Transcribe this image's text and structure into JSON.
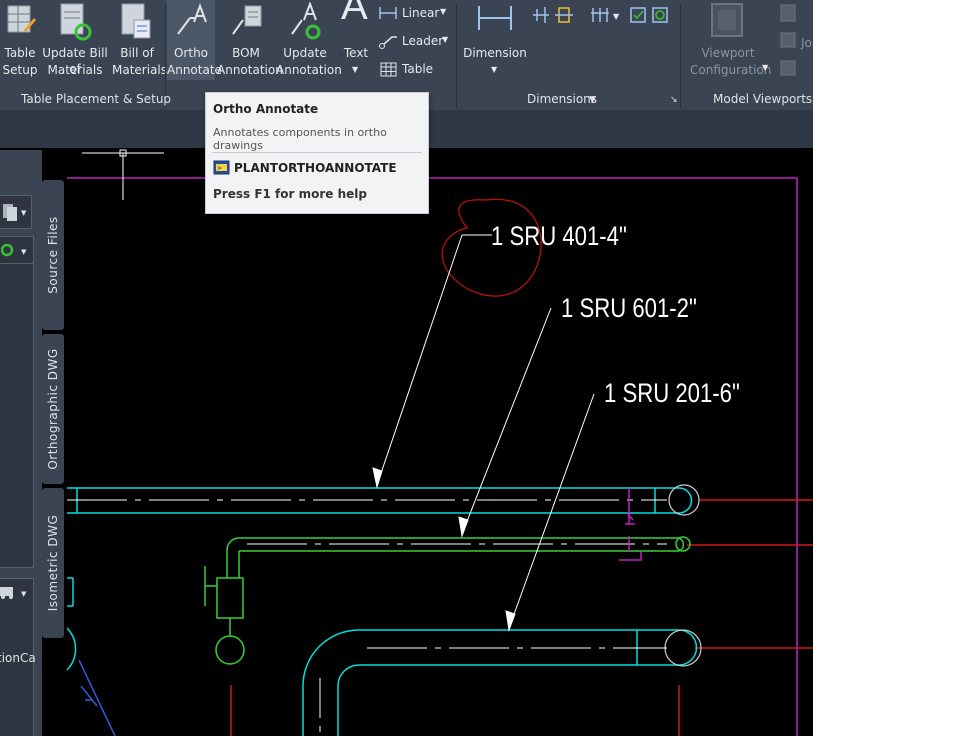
{
  "ribbon": {
    "buttons": {
      "table_setup": [
        "Table",
        "Setup"
      ],
      "update_bom": [
        "Update Bill of",
        "Materials"
      ],
      "bill_of_materials": [
        "Bill of",
        "Materials"
      ],
      "ortho_annotate": [
        "Ortho",
        "Annotate"
      ],
      "bom_annotation": [
        "BOM",
        "Annotation"
      ],
      "update_annotation": [
        "Update",
        "Annotation"
      ],
      "text": "Text",
      "linear": "Linear",
      "leader": "Leader",
      "table": "Table",
      "dimension": "Dimension",
      "viewport_configuration": [
        "Viewport",
        "Configuration"
      ],
      "jo_partial": "Jo"
    },
    "panels": {
      "table_placement": "Table Placement & Setup",
      "dimensions": "Dimensions",
      "model_viewports": "Model Viewports"
    }
  },
  "tooltip": {
    "title": "Ortho Annotate",
    "description": "Annotates components in ortho drawings",
    "command": "PLANTORTHOANNOTATE",
    "help": "Press F1 for more help"
  },
  "palette": {
    "tabs": [
      "Source Files",
      "Orthographic DWG",
      "Isometric DWG"
    ],
    "partial_label": "tionCa"
  },
  "drawing": {
    "labels": [
      "1 SRU 401-4\"",
      "1 SRU 601-2\"",
      "1 SRU 201-6\""
    ]
  },
  "colors": {
    "ribbon_bg": "#3b4453",
    "canvas_bg": "#000000",
    "pipe_cyan": "#00e0e0",
    "pipe_green": "#35d135",
    "border_magenta": "#c020c0",
    "centerline_red": "#d01818",
    "revision_cloud": "#c41010"
  }
}
